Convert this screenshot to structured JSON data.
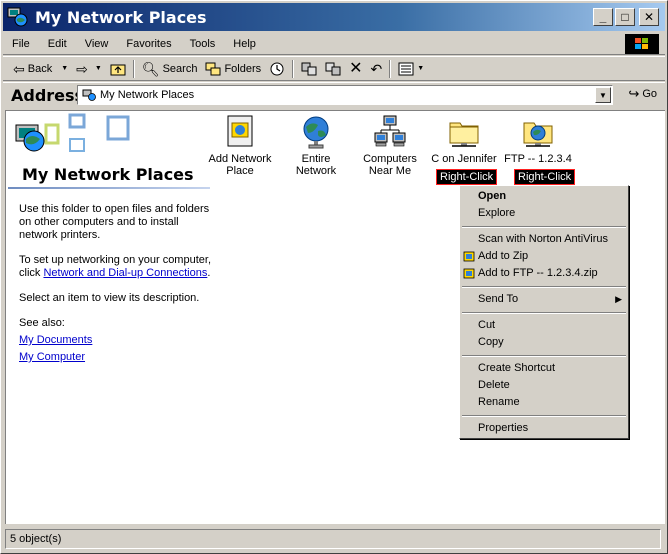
{
  "window": {
    "title": "My Network Places",
    "minimize_glyph": "_",
    "maximize_glyph": "□",
    "close_glyph": "✕"
  },
  "menubar": {
    "items": [
      "File",
      "Edit",
      "View",
      "Favorites",
      "Tools",
      "Help"
    ]
  },
  "toolbar": {
    "back_label": "Back",
    "search_label": "Search",
    "folders_label": "Folders"
  },
  "address": {
    "label": "Address",
    "value": "My Network Places",
    "go_label": "Go"
  },
  "banner": {
    "title": "My Network Places"
  },
  "leftpane": {
    "description": "Use this folder to open files and folders on other computers and to install network printers.",
    "setup_prefix": "To set up networking on your computer, click ",
    "setup_link": "Network and Dial-up Connections",
    "setup_suffix": ".",
    "select_hint": "Select an item to view its description.",
    "see_also": "See also:",
    "links": [
      "My Documents",
      "My Computer"
    ]
  },
  "items": [
    {
      "label": "Add Network Place",
      "icon": "add-network-place-icon"
    },
    {
      "label": "Entire Network",
      "icon": "globe-icon"
    },
    {
      "label": "Computers Near Me",
      "icon": "computers-icon"
    },
    {
      "label": "C on Jennifer",
      "icon": "network-folder-icon"
    },
    {
      "label": "FTP -- 1.2.3.4",
      "icon": "ftp-folder-icon"
    }
  ],
  "annotations": [
    "Right-Click",
    "Right-Click"
  ],
  "context_menu": {
    "groups": [
      [
        "Open",
        "Explore"
      ],
      [
        "Scan with Norton AntiVirus",
        "Add to Zip",
        "Add to FTP -- 1.2.3.4.zip"
      ],
      [
        "Send To"
      ],
      [
        "Cut",
        "Copy"
      ],
      [
        "Create Shortcut",
        "Delete",
        "Rename"
      ],
      [
        "Properties"
      ]
    ]
  },
  "status": {
    "text": "5 object(s)"
  },
  "colors": {
    "titlebar_start": "#0a246a",
    "titlebar_end": "#a6caf0",
    "face": "#d4d0c8",
    "link": "#0000cc",
    "annotation_border": "#ff2020"
  }
}
